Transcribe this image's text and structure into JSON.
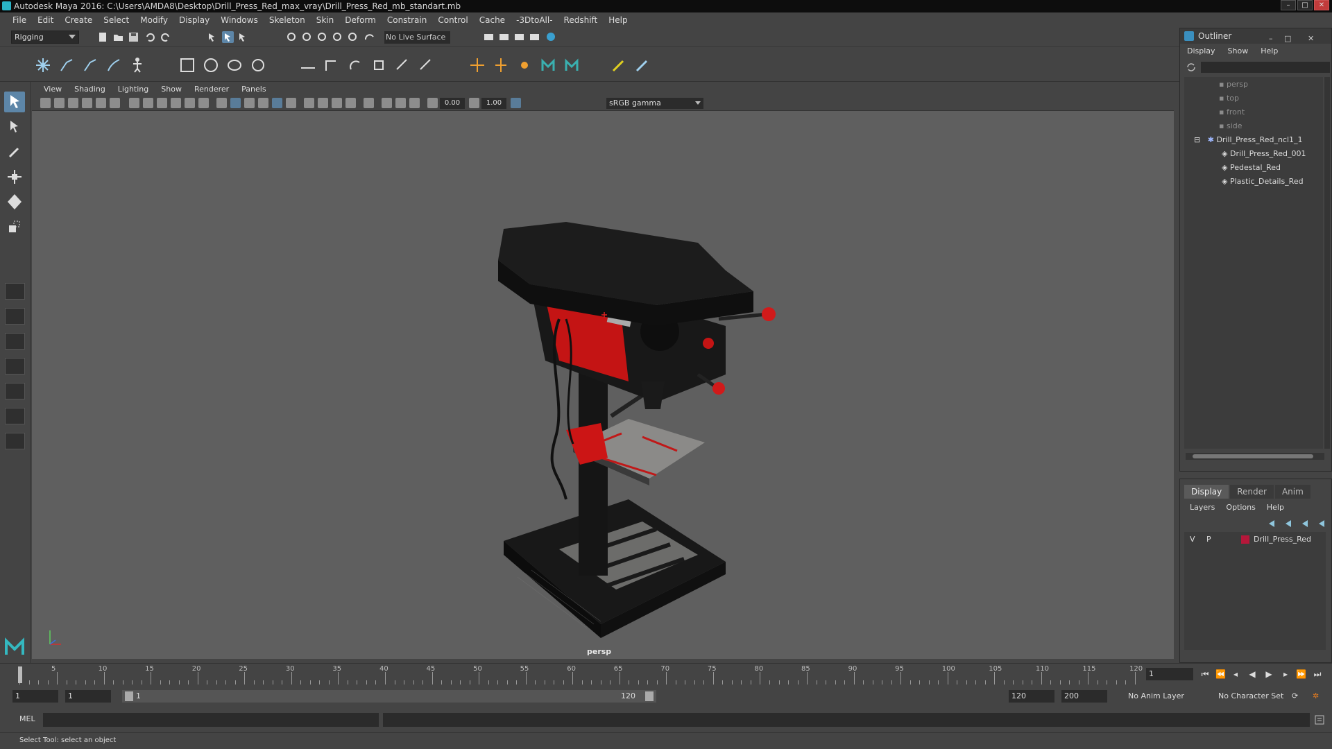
{
  "window": {
    "title": "Autodesk Maya 2016: C:\\Users\\AMDA8\\Desktop\\Drill_Press_Red_max_vray\\Drill_Press_Red_mb_standart.mb"
  },
  "menubar": [
    "File",
    "Edit",
    "Create",
    "Select",
    "Modify",
    "Display",
    "Windows",
    "Skeleton",
    "Skin",
    "Deform",
    "Constrain",
    "Control",
    "Cache",
    "-3DtoAll-",
    "Redshift",
    "Help"
  ],
  "status": {
    "mode": "Rigging",
    "live_surface": "No Live Surface"
  },
  "viewport": {
    "menu": [
      "View",
      "Shading",
      "Lighting",
      "Show",
      "Renderer",
      "Panels"
    ],
    "exposure": "0.00",
    "gamma": "1.00",
    "color_space": "sRGB gamma",
    "camera_label": "persp"
  },
  "outliner": {
    "title": "Outliner",
    "menu": [
      "Display",
      "Show",
      "Help"
    ],
    "items": [
      {
        "label": "persp",
        "kind": "camera"
      },
      {
        "label": "top",
        "kind": "camera"
      },
      {
        "label": "front",
        "kind": "camera"
      },
      {
        "label": "side",
        "kind": "camera"
      },
      {
        "label": "Drill_Press_Red_ncl1_1",
        "kind": "group"
      },
      {
        "label": "Drill_Press_Red_001",
        "kind": "mesh"
      },
      {
        "label": "Pedestal_Red",
        "kind": "mesh"
      },
      {
        "label": "Plastic_Details_Red",
        "kind": "mesh"
      }
    ]
  },
  "layers": {
    "tabs": [
      "Display",
      "Render",
      "Anim"
    ],
    "menu": [
      "Layers",
      "Options",
      "Help"
    ],
    "rows": [
      {
        "v": "V",
        "p": "P",
        "name": "Drill_Press_Red",
        "color": "#b5173a"
      }
    ]
  },
  "timeline": {
    "ticks": [
      "5",
      "10",
      "15",
      "20",
      "25",
      "30",
      "35",
      "40",
      "45",
      "50",
      "55",
      "60",
      "65",
      "70",
      "75",
      "80",
      "85",
      "90",
      "95",
      "100",
      "105",
      "110",
      "115",
      "120"
    ],
    "start_tick": "1",
    "current_frame": "1"
  },
  "range": {
    "start": "1",
    "playback_start": "1",
    "slider_start": "1",
    "slider_end": "120",
    "playback_end": "120",
    "end": "200",
    "anim_layer": "No Anim Layer",
    "char_set": "No Character Set"
  },
  "cmd": {
    "label": "MEL"
  },
  "help": {
    "text": "Select Tool: select an object"
  },
  "colors": {
    "accent": "#5d86a8",
    "drill_red": "#d01818",
    "viewport_bg": "#5f5f5f"
  }
}
